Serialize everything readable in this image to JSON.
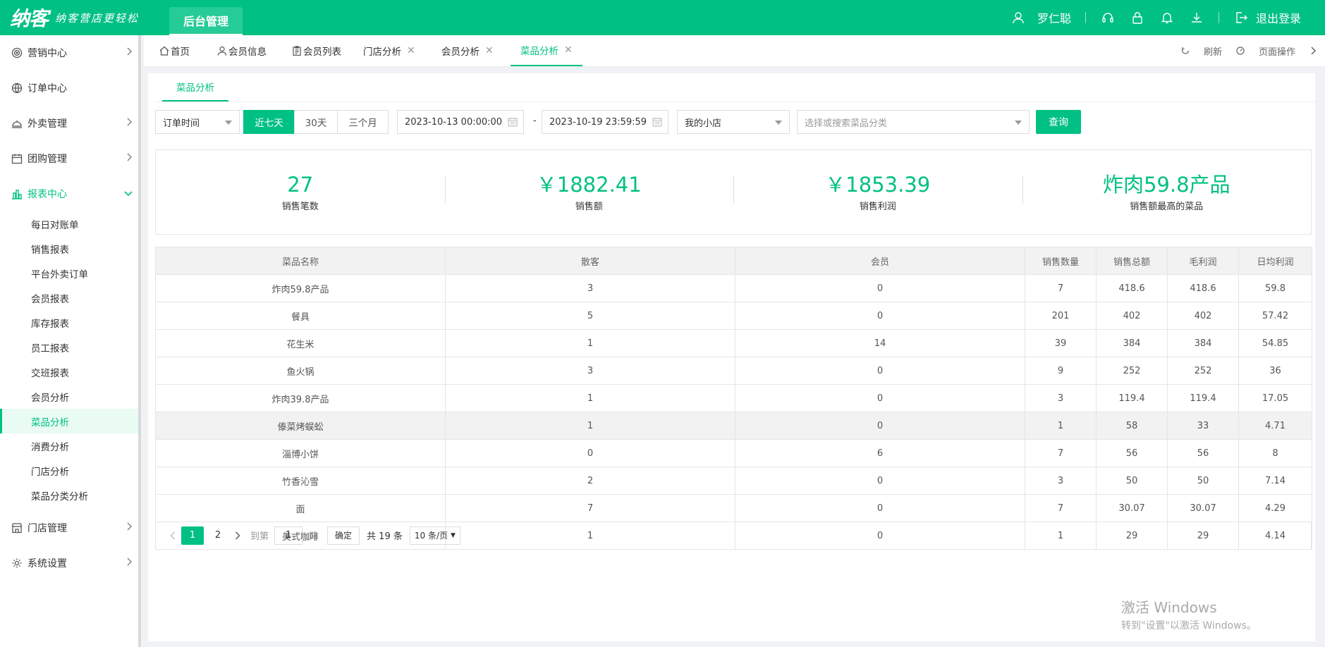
{
  "brand": {
    "logo": "纳客",
    "slogan": "纳客营店更轻松",
    "admin_tab": "后台管理"
  },
  "header": {
    "user_name": "罗仁聪",
    "logout": "退出登录"
  },
  "sidebar": {
    "groups": [
      {
        "label": "营销中心"
      },
      {
        "label": "订单中心"
      },
      {
        "label": "外卖管理"
      },
      {
        "label": "团购管理"
      },
      {
        "label": "报表中心"
      },
      {
        "label": "门店管理"
      },
      {
        "label": "系统设置"
      }
    ],
    "report_items": [
      "每日对账单",
      "销售报表",
      "平台外卖订单",
      "会员报表",
      "库存报表",
      "员工报表",
      "交班报表",
      "会员分析",
      "菜品分析",
      "消费分析",
      "门店分析",
      "菜品分类分析"
    ]
  },
  "tabs": [
    {
      "label": "首页"
    },
    {
      "label": "会员信息"
    },
    {
      "label": "会员列表"
    },
    {
      "label": "门店分析"
    },
    {
      "label": "会员分析"
    },
    {
      "label": "菜品分析"
    }
  ],
  "tab_tools": {
    "refresh": "刷新",
    "page_ops": "页面操作"
  },
  "subtab": "菜品分析",
  "filters": {
    "time_type": "订单时间",
    "ranges": [
      "近七天",
      "30天",
      "三个月"
    ],
    "start": "2023-10-13 00:00:00",
    "end": "2023-10-19 23:59:59",
    "dash": "-",
    "store": "我的小店",
    "category_placeholder": "选择或搜索菜品分类",
    "query": "查询"
  },
  "summary": [
    {
      "value": "27",
      "label": "销售笔数"
    },
    {
      "value": "￥1882.41",
      "label": "销售额"
    },
    {
      "value": "￥1853.39",
      "label": "销售利润"
    },
    {
      "value": "炸肉59.8产品",
      "label": "销售额最高的菜品"
    }
  ],
  "table": {
    "headers": [
      "菜品名称",
      "散客",
      "会员",
      "销售数量",
      "销售总额",
      "毛利润",
      "日均利润"
    ],
    "rows": [
      [
        "炸肉59.8产品",
        "3",
        "0",
        "7",
        "418.6",
        "418.6",
        "59.8"
      ],
      [
        "餐具",
        "5",
        "0",
        "201",
        "402",
        "402",
        "57.42"
      ],
      [
        "花生米",
        "1",
        "14",
        "39",
        "384",
        "384",
        "54.85"
      ],
      [
        "鱼火锅",
        "3",
        "0",
        "9",
        "252",
        "252",
        "36"
      ],
      [
        "炸肉39.8产品",
        "1",
        "0",
        "3",
        "119.4",
        "119.4",
        "17.05"
      ],
      [
        "傣菜烤蜈蚣",
        "1",
        "0",
        "1",
        "58",
        "33",
        "4.71"
      ],
      [
        "淄博小饼",
        "0",
        "6",
        "7",
        "56",
        "56",
        "8"
      ],
      [
        "竹香沁雪",
        "2",
        "0",
        "3",
        "50",
        "50",
        "7.14"
      ],
      [
        "面",
        "7",
        "0",
        "7",
        "30.07",
        "30.07",
        "4.29"
      ],
      [
        "美式咖啡",
        "1",
        "0",
        "1",
        "29",
        "29",
        "4.14"
      ]
    ]
  },
  "pager": {
    "pages": [
      "1",
      "2"
    ],
    "goto_label": "到第",
    "goto_value": "1",
    "page_unit": "页",
    "confirm": "确定",
    "total": "共 19 条",
    "page_size": "10 条/页"
  },
  "watermark": {
    "line1": "激活 Windows",
    "line2": "转到\"设置\"以激活 Windows。"
  },
  "colors": {
    "primary": "#00c083"
  }
}
